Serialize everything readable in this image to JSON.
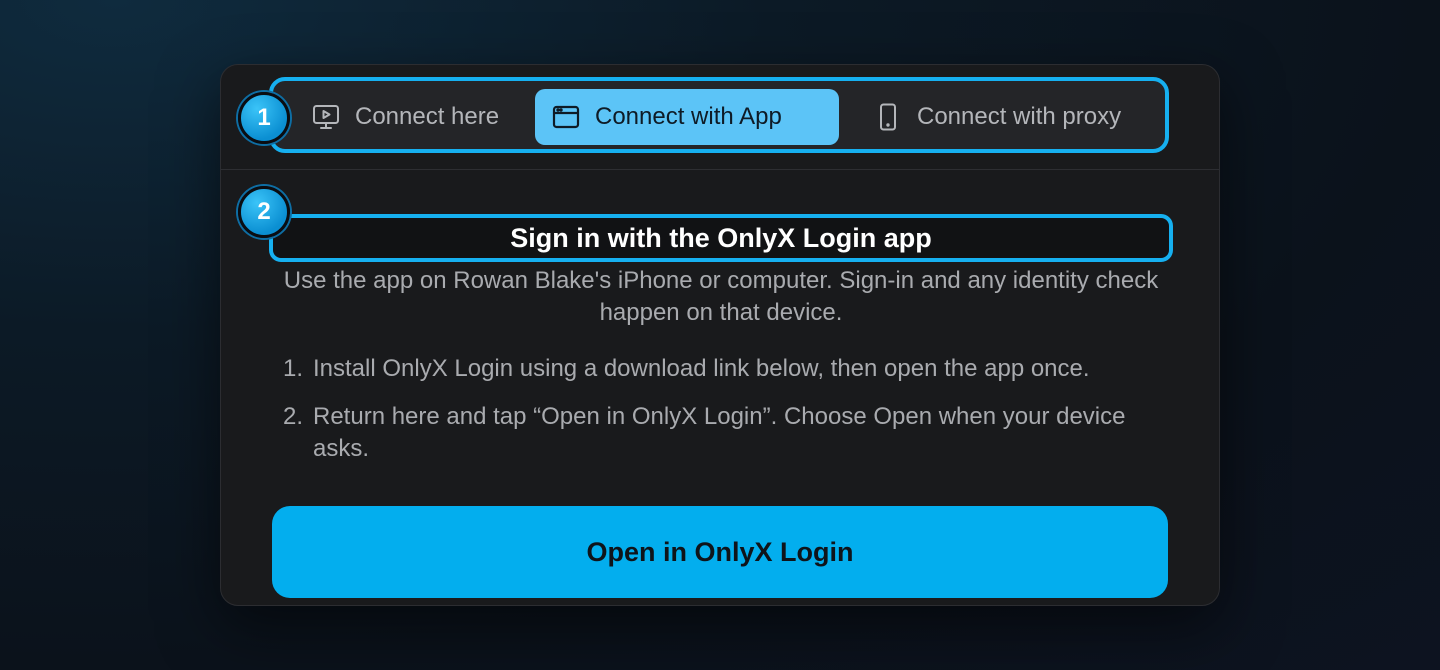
{
  "tabs": [
    {
      "label": "Connect here",
      "icon": "monitor-play-icon",
      "selected": false
    },
    {
      "label": "Connect with App",
      "icon": "app-window-icon",
      "selected": true
    },
    {
      "label": "Connect with proxy",
      "icon": "phone-icon",
      "selected": false
    }
  ],
  "annotations": {
    "step1": "1",
    "step2": "2"
  },
  "content": {
    "title": "Sign in with the OnlyX Login app",
    "subtitle": "Use the app on Rowan Blake's iPhone or computer. Sign-in and any identity check happen on that device.",
    "steps": [
      {
        "num": "1.",
        "text": "Install OnlyX Login using a download link below, then open the app once."
      },
      {
        "num": "2.",
        "text": "Return here and tap “Open in OnlyX Login”. Choose Open when your device asks."
      }
    ],
    "primary_button": "Open in OnlyX Login"
  },
  "colors": {
    "accent": "#03aeee",
    "selected_tab": "#5cc4f7",
    "highlight_border": "#16b0f0",
    "card_bg": "#191a1c"
  }
}
